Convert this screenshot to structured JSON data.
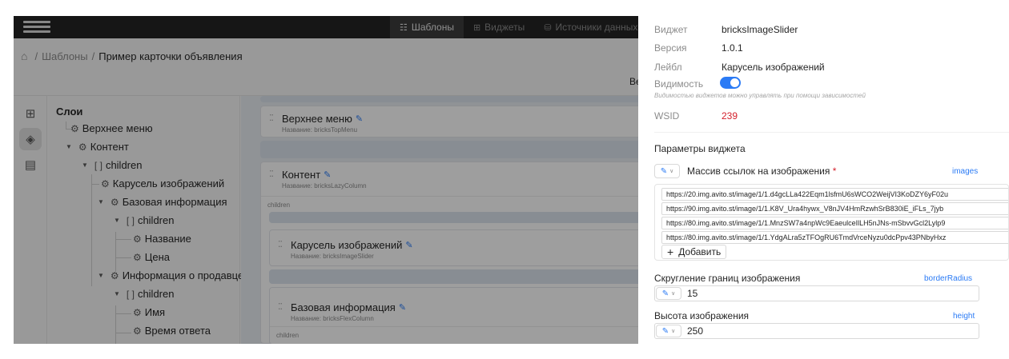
{
  "topbar": {
    "tabs": [
      {
        "icon": "grid-icon",
        "glyph": "☷",
        "label": "Шаблоны",
        "active": true
      },
      {
        "icon": "widgets-icon",
        "glyph": "⊞",
        "label": "Виджеты",
        "active": false
      },
      {
        "icon": "database-icon",
        "glyph": "⛁",
        "label": "Источники данных",
        "active": false
      }
    ]
  },
  "breadcrumb": {
    "root": "Шаблоны",
    "separator": "/",
    "current": "Пример карточки объявления"
  },
  "version_label": "Вер",
  "layers": {
    "title": "Слои",
    "items": [
      {
        "label": "Верхнее меню",
        "icon": "widget-icon"
      },
      {
        "label": "Контент",
        "icon": "widget-icon"
      },
      {
        "label": "children",
        "icon": "brackets-icon"
      },
      {
        "label": "Карусель изображений",
        "icon": "widget-icon"
      },
      {
        "label": "Базовая информация",
        "icon": "widget-icon"
      },
      {
        "label": "children",
        "icon": "brackets-icon"
      },
      {
        "label": "Название",
        "icon": "widget-icon"
      },
      {
        "label": "Цена",
        "icon": "widget-icon"
      },
      {
        "label": "Информация о продавце",
        "icon": "widget-icon"
      },
      {
        "label": "children",
        "icon": "brackets-icon"
      },
      {
        "label": "Имя",
        "icon": "widget-icon"
      },
      {
        "label": "Время ответа",
        "icon": "widget-icon"
      }
    ]
  },
  "canvas": {
    "name_prefix": "Название:",
    "children_label": "children",
    "cards": [
      {
        "title": "Верхнее меню",
        "name": "bricksTopMenu"
      },
      {
        "title": "Контент",
        "name": "bricksLazyColumn"
      },
      {
        "title": "Карусель изображений",
        "name": "bricksImageSlider"
      },
      {
        "title": "Базовая информация",
        "name": "bricksFlexColumn"
      }
    ]
  },
  "panel": {
    "widget_key": "Виджет",
    "widget_val": "bricksImageSlider",
    "version_key": "Версия",
    "version_val": "1.0.1",
    "label_key": "Лейбл",
    "label_val": "Карусель изображений",
    "visibility_key": "Видимость",
    "visibility_on": true,
    "visibility_hint": "Видимостью виджетов можно управлять при помощи зависимостей",
    "wsid_key": "WSID",
    "wsid_val": "239",
    "params_title": "Параметры виджета",
    "images_field": {
      "label": "Массив ссылок на изображения",
      "required_mark": "*",
      "key": "images",
      "urls": [
        "https://20.img.avito.st/image/1/1.d4gcLLa422Eqm1lsfmU6sWCO2WeijVI3KoDZY6yF02u",
        "https://90.img.avito.st/image/1/1.K8V_Ura4hywx_V8nJV4HmRzwhSrB830iE_iFLs_7jyb",
        "https://80.img.avito.st/image/1/1.MnzSW7a4npWc9EaeulceIlLH5nJNs-mSbvvGcl2Lylp9",
        "https://80.img.avito.st/image/1/1.YdgALra5zTFOgRU6TmdVrceNyzu0dcPpv43PNbyHxz"
      ],
      "add_label": "Добавить"
    },
    "radius_field": {
      "label": "Скругление границ изображения",
      "key": "borderRadius",
      "value": "15"
    },
    "height_field": {
      "label": "Высота изображения",
      "key": "height",
      "value": "250"
    }
  },
  "colors": {
    "accent": "#2b7bf5",
    "wsid": "#d4202c",
    "topbar": "#242424"
  }
}
